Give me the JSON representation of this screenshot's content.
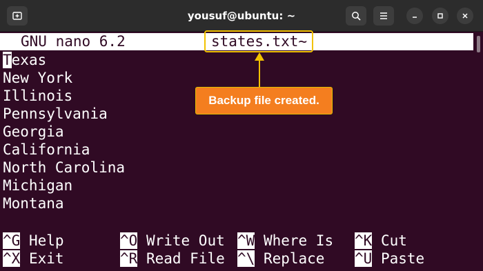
{
  "window": {
    "title": "yousuf@ubuntu: ~"
  },
  "nano": {
    "version_label": "GNU nano 6.2",
    "filename": "states.txt~",
    "first_char": "T",
    "first_rest": "exas",
    "lines": [
      "New York",
      "Illinois",
      "Pennsylvania",
      "Georgia",
      "California",
      "North Carolina",
      "Michigan",
      "Montana"
    ],
    "shortcuts_row1": [
      {
        "key": "^G",
        "label": "Help"
      },
      {
        "key": "^O",
        "label": "Write Out"
      },
      {
        "key": "^W",
        "label": "Where Is"
      },
      {
        "key": "^K",
        "label": "Cut"
      }
    ],
    "shortcuts_row2": [
      {
        "key": "^X",
        "label": "Exit"
      },
      {
        "key": "^R",
        "label": "Read File"
      },
      {
        "key": "^\\",
        "label": "Replace"
      },
      {
        "key": "^U",
        "label": "Paste"
      }
    ]
  },
  "annotation": {
    "text": "Backup file created.",
    "color": "#f47e1f",
    "outline": "#f2c200"
  }
}
